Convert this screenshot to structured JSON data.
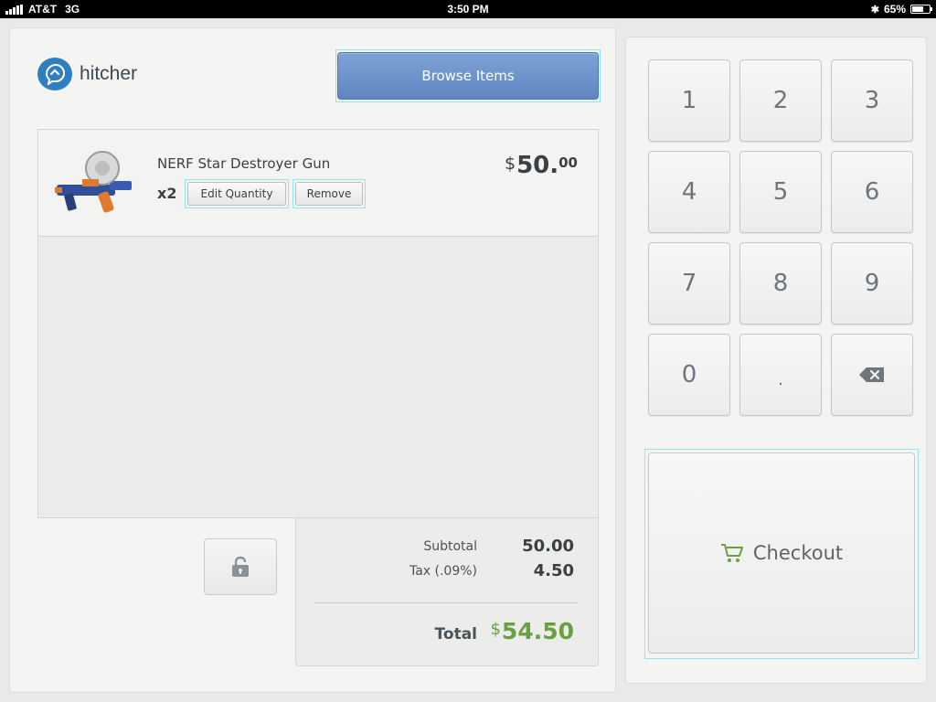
{
  "status_bar": {
    "carrier": "AT&T",
    "network": "3G",
    "time": "3:50 PM",
    "battery": "65%",
    "battery_level": 0.65
  },
  "app": {
    "logo_text": "hitcher",
    "browse_label": "Browse Items"
  },
  "cart": {
    "items": [
      {
        "name": "NERF Star Destroyer Gun",
        "quantity": "x2",
        "edit_label": "Edit Quantity",
        "remove_label": "Remove",
        "price_currency": "$",
        "price_whole": "50.",
        "price_cents": "00"
      }
    ]
  },
  "totals": {
    "subtotal_label": "Subtotal",
    "subtotal_value": "50.00",
    "tax_label": "Tax (.09%)",
    "tax_value": "4.50",
    "total_label": "Total",
    "total_currency": "$",
    "total_value": "54.50"
  },
  "keypad": {
    "keys": [
      "1",
      "2",
      "3",
      "4",
      "5",
      "6",
      "7",
      "8",
      "9",
      "0",
      "."
    ]
  },
  "checkout": {
    "label": "Checkout"
  },
  "colors": {
    "accent_blue": "#5f86c1",
    "total_green": "#6aa043",
    "logo_blue": "#2e7fc2"
  }
}
